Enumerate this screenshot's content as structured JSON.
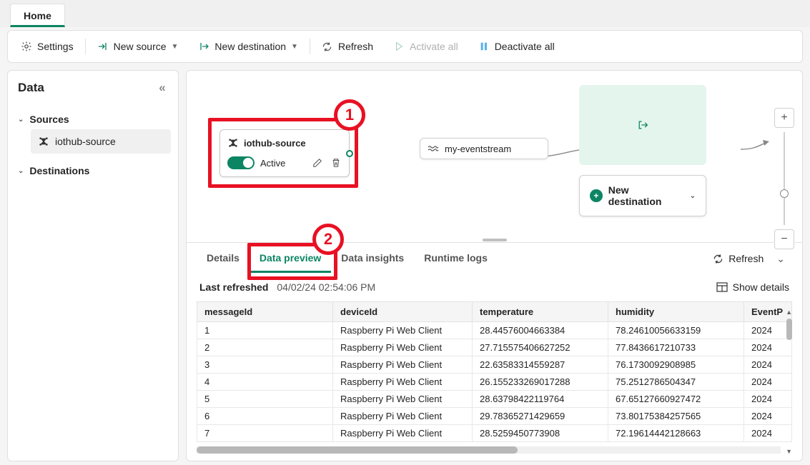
{
  "top_tab": "Home",
  "toolbar": {
    "settings": "Settings",
    "new_source": "New source",
    "new_destination": "New destination",
    "refresh": "Refresh",
    "activate_all": "Activate all",
    "deactivate_all": "Deactivate all"
  },
  "sidebar": {
    "title": "Data",
    "sources_label": "Sources",
    "source_item": "iothub-source",
    "destinations_label": "Destinations"
  },
  "canvas": {
    "source_node": {
      "title": "iothub-source",
      "status": "Active"
    },
    "stream_node": "my-eventstream",
    "new_destination": "New destination"
  },
  "annotations": {
    "one": "1",
    "two": "2"
  },
  "bottom": {
    "tabs": {
      "details": "Details",
      "data_preview": "Data preview",
      "data_insights": "Data insights",
      "runtime_logs": "Runtime logs"
    },
    "refresh": "Refresh",
    "last_refreshed_label": "Last refreshed",
    "last_refreshed_time": "04/02/24 02:54:06 PM",
    "show_details": "Show details",
    "columns": {
      "messageId": "messageId",
      "deviceId": "deviceId",
      "temperature": "temperature",
      "humidity": "humidity",
      "eventProcessed": "EventP"
    },
    "rows": [
      {
        "messageId": "1",
        "deviceId": "Raspberry Pi Web Client",
        "temperature": "28.44576004663384",
        "humidity": "78.24610056633159",
        "event": "2024"
      },
      {
        "messageId": "2",
        "deviceId": "Raspberry Pi Web Client",
        "temperature": "27.715575406627252",
        "humidity": "77.8436617210733",
        "event": "2024"
      },
      {
        "messageId": "3",
        "deviceId": "Raspberry Pi Web Client",
        "temperature": "22.63583314559287",
        "humidity": "76.1730092908985",
        "event": "2024"
      },
      {
        "messageId": "4",
        "deviceId": "Raspberry Pi Web Client",
        "temperature": "26.155233269017288",
        "humidity": "75.2512786504347",
        "event": "2024"
      },
      {
        "messageId": "5",
        "deviceId": "Raspberry Pi Web Client",
        "temperature": "28.63798422119764",
        "humidity": "67.65127660927472",
        "event": "2024"
      },
      {
        "messageId": "6",
        "deviceId": "Raspberry Pi Web Client",
        "temperature": "29.78365271429659",
        "humidity": "73.80175384257565",
        "event": "2024"
      },
      {
        "messageId": "7",
        "deviceId": "Raspberry Pi Web Client",
        "temperature": "28.5259450773908",
        "humidity": "72.19614442128663",
        "event": "2024"
      }
    ]
  }
}
